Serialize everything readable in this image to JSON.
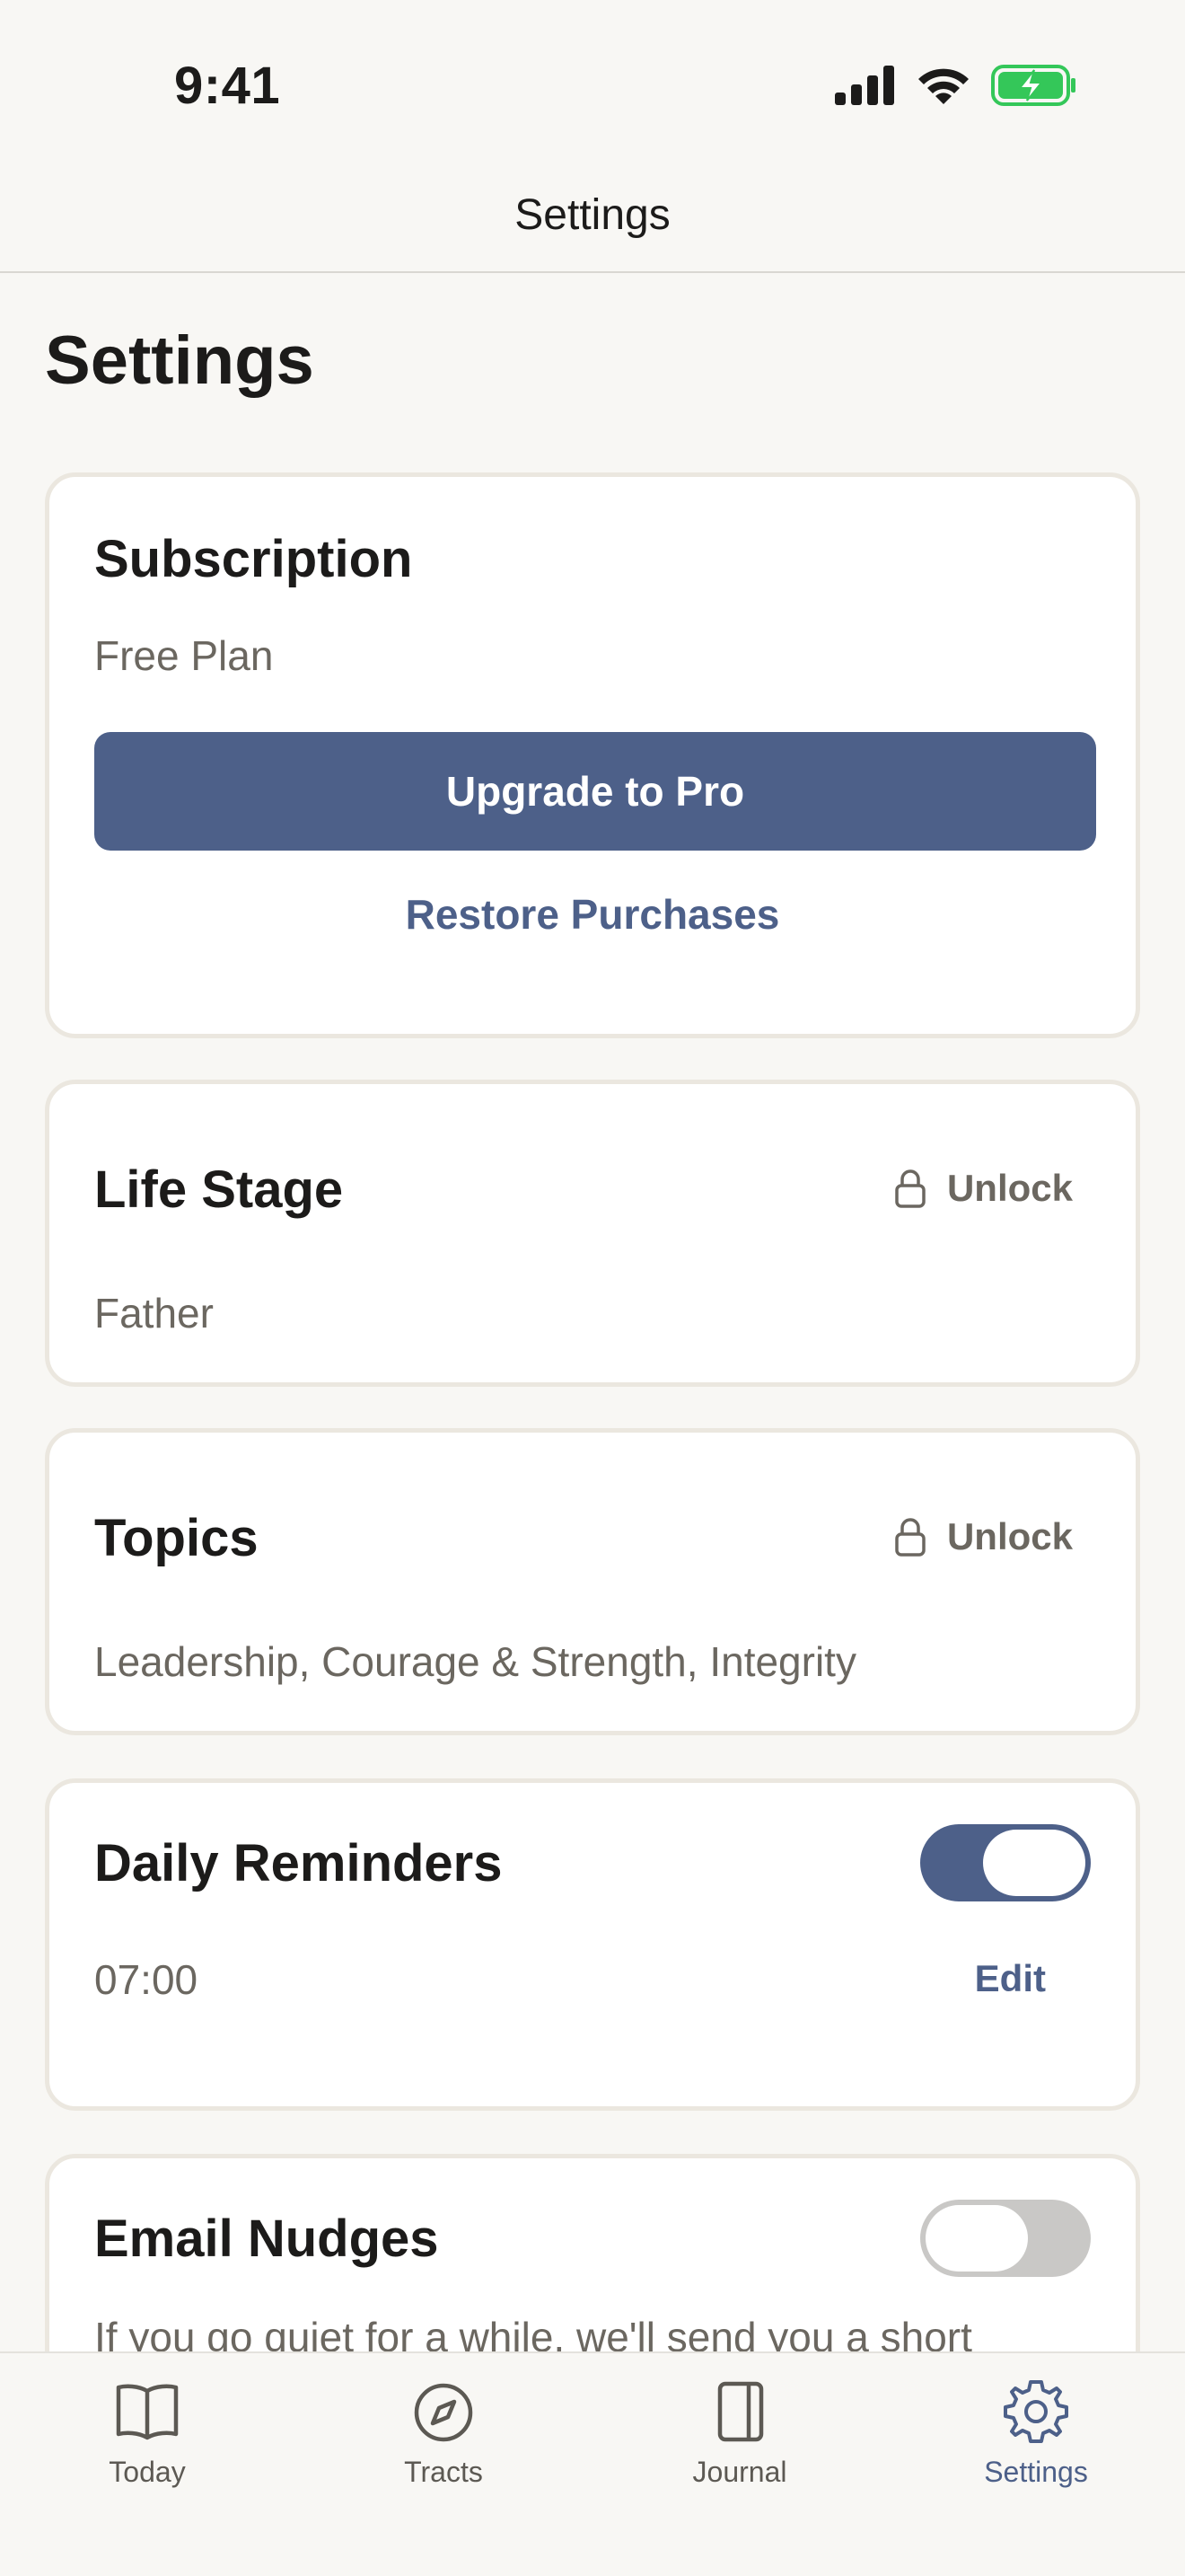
{
  "status_bar": {
    "time": "9:41"
  },
  "nav": {
    "title": "Settings"
  },
  "page": {
    "title": "Settings"
  },
  "subscription": {
    "title": "Subscription",
    "plan": "Free Plan",
    "upgrade_label": "Upgrade to Pro",
    "restore_label": "Restore Purchases"
  },
  "life_stage": {
    "title": "Life Stage",
    "unlock_label": "Unlock",
    "value": "Father"
  },
  "topics": {
    "title": "Topics",
    "unlock_label": "Unlock",
    "value": "Leadership, Courage & Strength, Integrity"
  },
  "daily_reminders": {
    "title": "Daily Reminders",
    "enabled": true,
    "time": "07:00",
    "edit_label": "Edit"
  },
  "email_nudges": {
    "title": "Email Nudges",
    "enabled": false,
    "description": "If you go quiet for a while, we'll send you a short"
  },
  "tabs": [
    {
      "label": "Today",
      "icon": "book-icon",
      "active": false
    },
    {
      "label": "Tracts",
      "icon": "compass-icon",
      "active": false
    },
    {
      "label": "Journal",
      "icon": "journal-icon",
      "active": false
    },
    {
      "label": "Settings",
      "icon": "gear-icon",
      "active": true
    }
  ],
  "colors": {
    "accent": "#4d6089",
    "background": "#f8f7f4",
    "battery": "#34c759"
  }
}
